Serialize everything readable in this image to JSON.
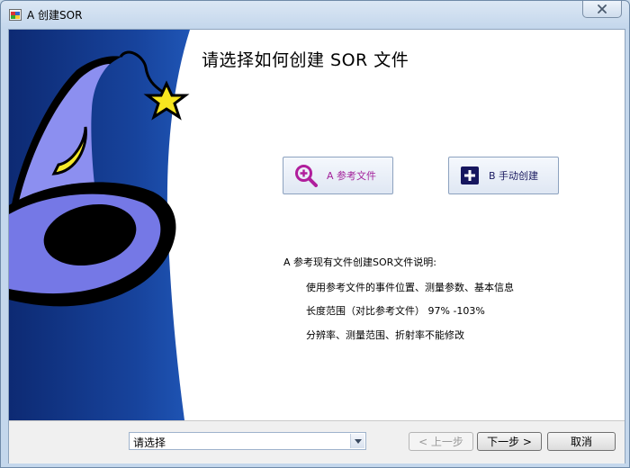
{
  "window": {
    "title": "A 创建SOR",
    "close_icon": "close-icon"
  },
  "content": {
    "title": "请选择如何创建 SOR 文件"
  },
  "options": {
    "reference": {
      "label": "A 参考文件",
      "icon": "magnifier-plus-icon",
      "color": "#a3229b"
    },
    "manual": {
      "label": "B 手动创建",
      "icon": "plus-square-icon",
      "color": "#1a1a60"
    }
  },
  "description": {
    "heading": "A 参考现有文件创建SOR文件说明:",
    "lines": [
      "使用参考文件的事件位置、测量参数、基本信息",
      "长度范围（对比参考文件） 97% -103%",
      "分辨率、测量范围、折射率不能修改"
    ]
  },
  "footer": {
    "combo_value": "请选择",
    "prev_label": "< 上一步",
    "next_label": "下一步 >",
    "cancel_label": "取消"
  }
}
